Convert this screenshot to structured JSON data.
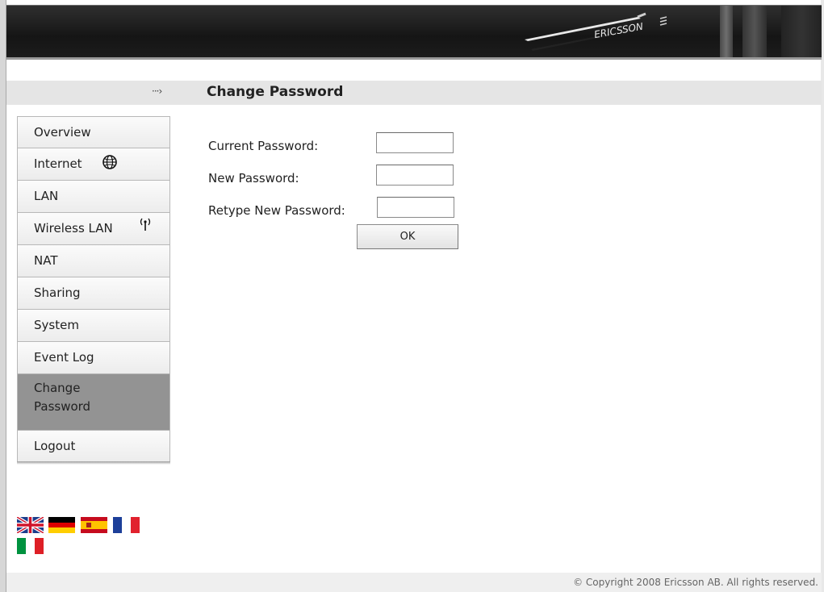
{
  "header": {
    "logo_text": "ERICSSON"
  },
  "titlebar": {
    "arrow": "···›",
    "title": "Change Password"
  },
  "sidebar": {
    "items": [
      {
        "label": "Overview",
        "icon": ""
      },
      {
        "label": "Internet",
        "icon": "globe-icon"
      },
      {
        "label": "LAN",
        "icon": ""
      },
      {
        "label": "Wireless LAN",
        "icon": "wireless-antenna-icon"
      },
      {
        "label": "NAT",
        "icon": ""
      },
      {
        "label": "Sharing",
        "icon": ""
      },
      {
        "label": "System",
        "icon": ""
      },
      {
        "label": "Event Log",
        "icon": ""
      },
      {
        "label": "Change Password",
        "icon": "",
        "active": true
      },
      {
        "label": "Logout",
        "icon": ""
      }
    ]
  },
  "form": {
    "current_password_label": "Current Password:",
    "current_password_value": "",
    "new_password_label": "New Password:",
    "new_password_value": "",
    "retype_password_label": "Retype New Password:",
    "retype_password_value": "",
    "ok_label": "OK"
  },
  "languages": [
    "English (UK flag)",
    "German",
    "Spanish",
    "French",
    "Italian"
  ],
  "footer": {
    "copyright": "© Copyright 2008 Ericsson AB. All rights reserved."
  },
  "colors": {
    "active_nav": "#939393",
    "header": "#1c1c1c",
    "titlebar": "#e5e5e5"
  }
}
